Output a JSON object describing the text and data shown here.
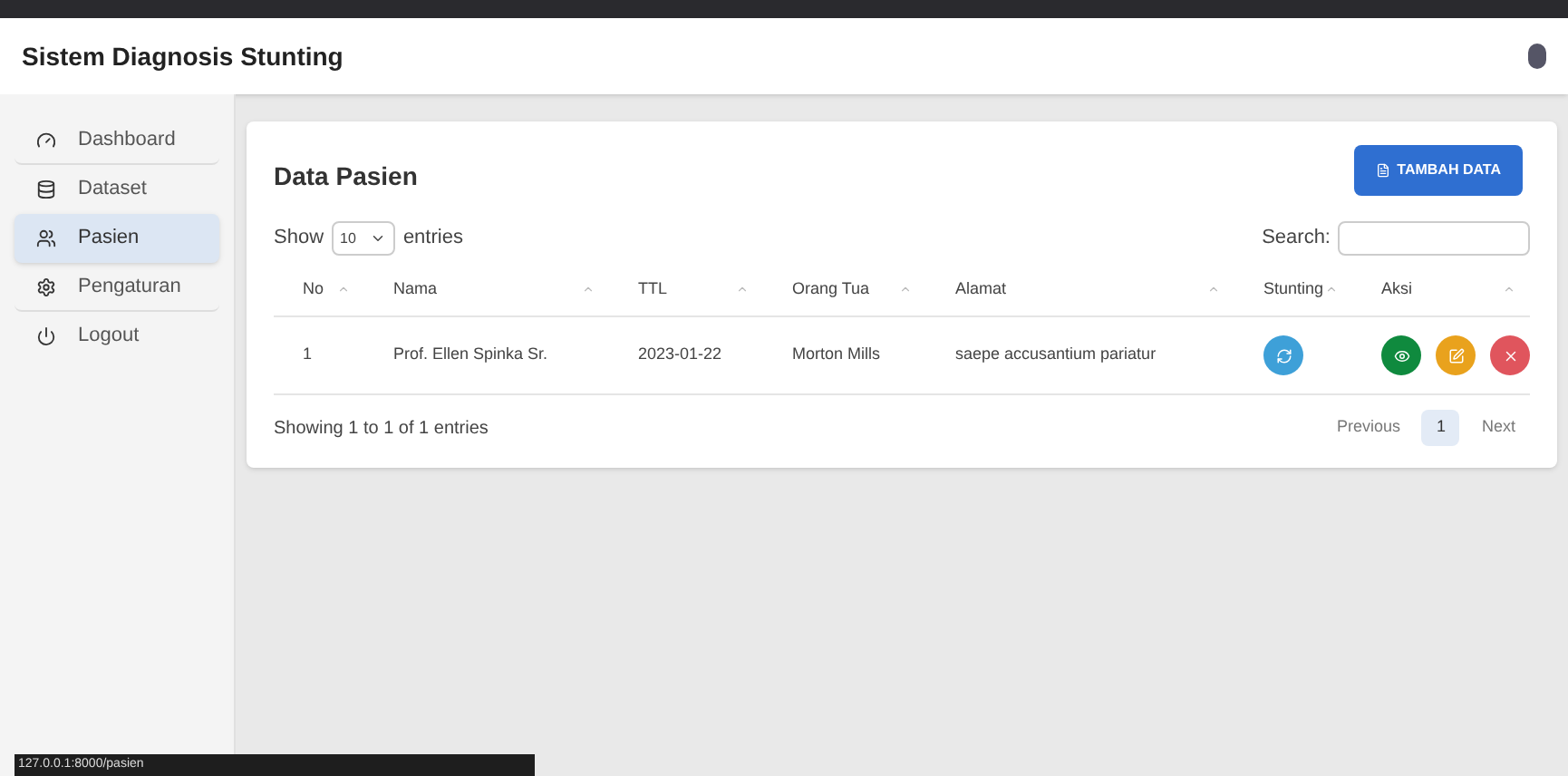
{
  "app": {
    "title": "Sistem Diagnosis Stunting"
  },
  "sidebar": {
    "items": [
      {
        "label": "Dashboard",
        "kind": "gauge",
        "selected": false
      },
      {
        "label": "Dataset",
        "kind": "database",
        "selected": false
      },
      {
        "label": "Pasien",
        "kind": "users",
        "selected": true
      },
      {
        "label": "Pengaturan",
        "kind": "gear",
        "selected": false
      },
      {
        "label": "Logout",
        "kind": "power",
        "selected": false
      }
    ]
  },
  "card": {
    "title": "Data Pasien",
    "add_button": "TAMBAH DATA",
    "show_label": "Show",
    "page_size": "10",
    "entries_label": "entries",
    "search_label": "Search:",
    "columns": [
      "No",
      "Nama",
      "TTL",
      "Orang Tua",
      "Alamat",
      "Stunting",
      "Aksi"
    ],
    "rows": [
      {
        "cells": [
          "1",
          "Prof. Ellen Spinka Sr.",
          "2023-01-22",
          "Morton Mills",
          "saepe accusantium pariatur"
        ]
      }
    ],
    "info": "Showing 1 to 1 of 1 entries",
    "pagination": [
      {
        "label": "Previous",
        "selected": false
      },
      {
        "label": "1",
        "selected": true
      },
      {
        "label": "Next",
        "selected": false
      }
    ]
  },
  "status_link": "127.0.0.1:8000/pasien"
}
